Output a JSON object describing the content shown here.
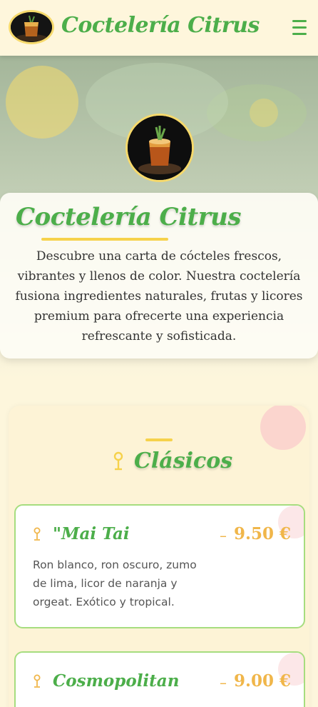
{
  "header": {
    "brand": "Coctelería Citrus",
    "logo_icon": "cocktail-glass-icon",
    "menu_icon": "hamburger-menu-icon"
  },
  "hero": {
    "title": "Coctelería Citrus",
    "description": "Descubre una carta de cócteles frescos, vibrantes y llenos de color. Nuestra coctelería fusiona ingredientes naturales, frutas y licores premium para ofrecerte una experiencia refrescante y sofisticada."
  },
  "menu": {
    "category": {
      "title": "Clásicos",
      "icon": "cocktail-icon"
    },
    "items": [
      {
        "name": "\"Mai Tai",
        "price": "9.50 €",
        "separator": "–",
        "description": "Ron blanco, ron oscuro, zumo de lima, licor de naranja y orgeat. Exótico y tropical.",
        "icon": "cocktail-icon"
      },
      {
        "name": "Cosmopolitan",
        "price": "9.00 €",
        "separator": "–",
        "description": "",
        "icon": "cocktail-icon"
      }
    ]
  },
  "colors": {
    "accent_green": "#4cae4a",
    "accent_yellow": "#f6d24b",
    "price_orange": "#f0b64a",
    "background": "#fdf6dc",
    "card_border": "#a6dd7f"
  }
}
